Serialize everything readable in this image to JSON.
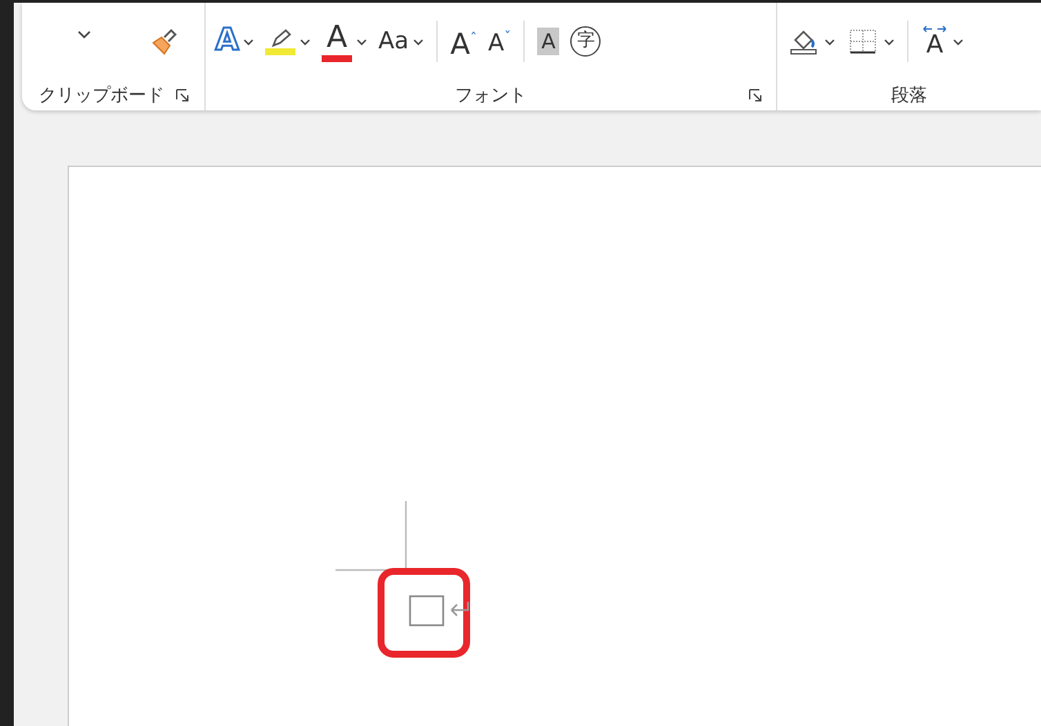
{
  "ribbon": {
    "groups": [
      {
        "label": "クリップボード",
        "launcher": true,
        "buttons": [
          {
            "kind": "paste-caret"
          },
          {
            "kind": "format-painter"
          }
        ]
      },
      {
        "label": "フォント",
        "launcher": true,
        "buttons": [
          {
            "kind": "text-effect",
            "glyph": "A",
            "dropdown": true
          },
          {
            "kind": "highlight",
            "dropdown": true,
            "color": "#f2e935"
          },
          {
            "kind": "font-color",
            "glyph": "A",
            "dropdown": true,
            "color": "#e8262b"
          },
          {
            "kind": "case",
            "glyph": "Aa",
            "dropdown": true
          },
          {
            "kind": "sep"
          },
          {
            "kind": "grow",
            "glyph": "A",
            "mark": "ˆ"
          },
          {
            "kind": "shrink",
            "glyph": "A",
            "mark": "ˇ"
          },
          {
            "kind": "sep"
          },
          {
            "kind": "shade",
            "glyph": "A"
          },
          {
            "kind": "enclose",
            "glyph": "字"
          }
        ]
      },
      {
        "label": "段落",
        "launcher": false,
        "buttons": [
          {
            "kind": "fill",
            "dropdown": true
          },
          {
            "kind": "borders",
            "dropdown": true
          },
          {
            "kind": "sep"
          },
          {
            "kind": "spacing",
            "glyph": "A",
            "dropdown": true
          }
        ]
      }
    ]
  }
}
